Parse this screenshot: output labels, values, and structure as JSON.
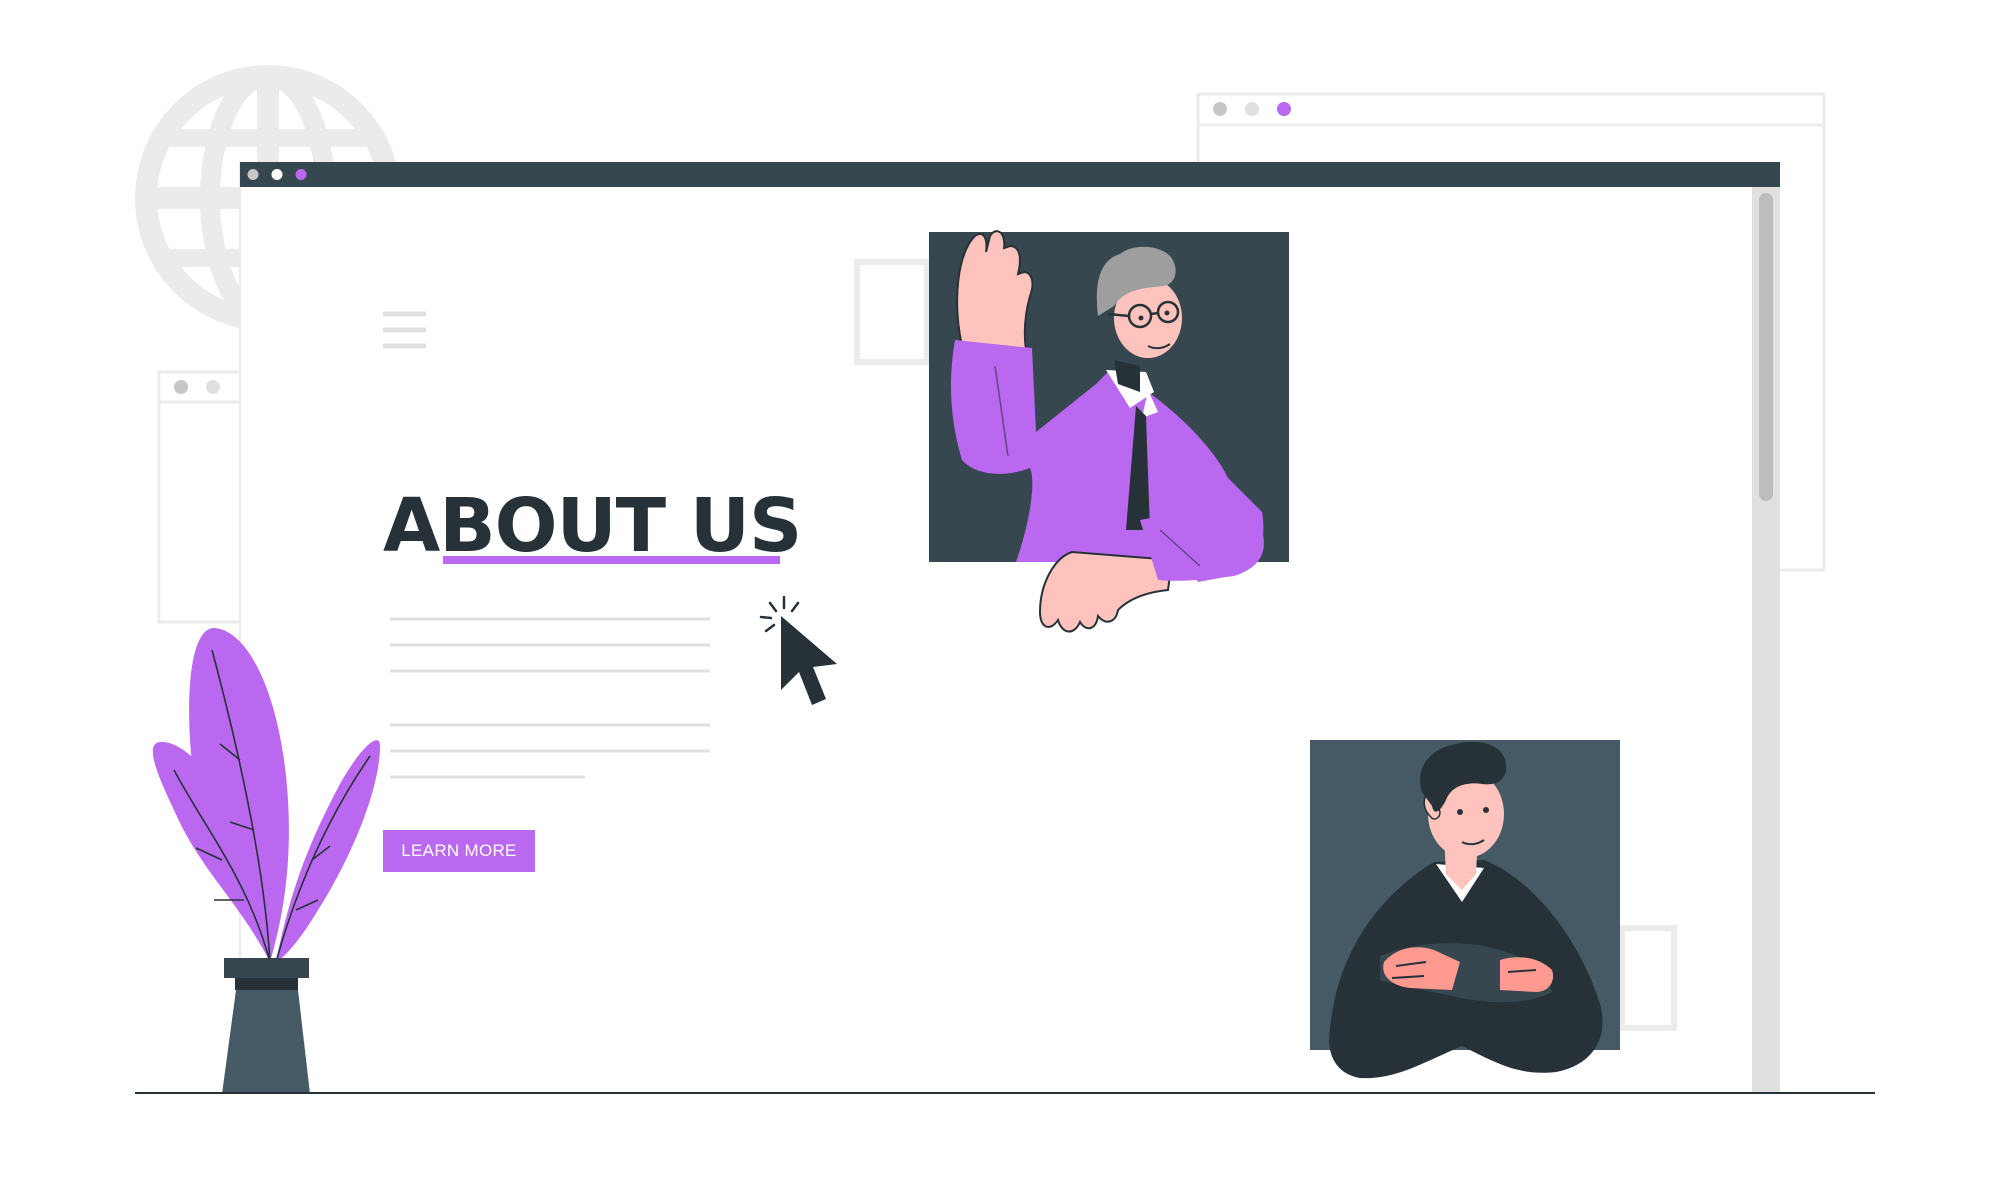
{
  "page": {
    "heading": "ABOUT US",
    "cta_label": "LEARN MORE"
  },
  "browser": {
    "window_controls": [
      "dot-gray",
      "dot-white",
      "dot-purple"
    ]
  },
  "icons": {
    "menu": "hamburger-icon",
    "pointer": "cursor-icon",
    "background": "globe-icon"
  },
  "colors": {
    "accent": "#ba68f0",
    "dark": "#263238",
    "titlebar": "#37474f",
    "panel": "#455a64",
    "skin": "#ffc3bd",
    "light_gray": "#ebebeb"
  }
}
